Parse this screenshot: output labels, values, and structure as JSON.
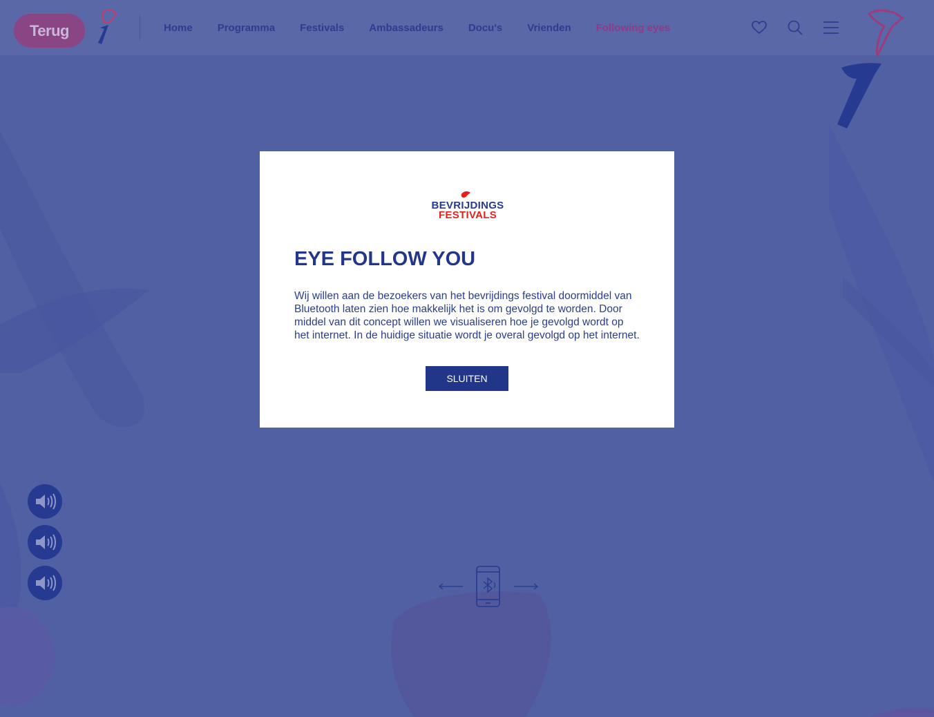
{
  "header": {
    "back_label": "Terug",
    "nav": [
      {
        "label": "Home",
        "active": false
      },
      {
        "label": "Programma",
        "active": false
      },
      {
        "label": "Festivals",
        "active": false
      },
      {
        "label": "Ambassadeurs",
        "active": false
      },
      {
        "label": "Docu's",
        "active": false
      },
      {
        "label": "Vrienden",
        "active": false
      },
      {
        "label": "Following eyes",
        "active": true
      }
    ],
    "icons": [
      "heart-icon",
      "search-icon",
      "menu-icon"
    ]
  },
  "modal": {
    "brand_top": "BEVRIJDINGS",
    "brand_bottom": "FESTIVALS",
    "title": "EYE FOLLOW YOU",
    "body": "Wij willen aan de bezoekers van het bevrijdings festival doormiddel van Bluetooth laten zien hoe makkelijk het is om gevolgd te worden. Door middel van dit concept willen we visualiseren hoe je gevolgd wordt op het internet. In de huidige situatie wordt je overal gevolgd op het internet.",
    "button_label": "SLUITEN"
  },
  "sound_buttons": [
    "speaker-icon",
    "speaker-icon",
    "speaker-icon"
  ],
  "colors": {
    "page_background": "#5060a2",
    "nav_text": "#2e3d8d",
    "nav_active": "#8b3d87",
    "back_button": "#8a4585",
    "modal_title": "#23368a",
    "modal_button": "#213688",
    "brand_red": "#e2231a",
    "sound_button": "#253a90"
  }
}
